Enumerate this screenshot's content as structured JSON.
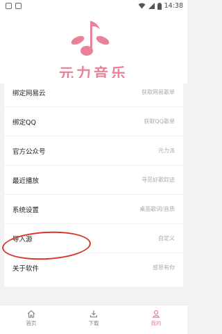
{
  "status": {
    "time": "14:38"
  },
  "app": {
    "title": "元力音乐"
  },
  "menu": [
    {
      "label": "绑定网易云",
      "hint": "获取网易歌单"
    },
    {
      "label": "绑定QQ",
      "hint": "获取QQ歌单"
    },
    {
      "label": "官方公众号",
      "hint": "元力派"
    },
    {
      "label": "最近播放",
      "hint": "寻觅好歌踪迹"
    },
    {
      "label": "系统设置",
      "hint": "桌面歌词/音质"
    },
    {
      "label": "导入源",
      "hint": "自定义"
    },
    {
      "label": "关于软件",
      "hint": "感恩有你"
    }
  ],
  "tabs": [
    {
      "label": "首页"
    },
    {
      "label": "下载"
    },
    {
      "label": "我的"
    }
  ],
  "colors": {
    "brand": "#e8829a",
    "annotation": "#d9342b"
  },
  "icons": [
    "home-icon",
    "download-icon",
    "user-icon",
    "wifi-icon",
    "signal-icon",
    "battery-icon"
  ]
}
